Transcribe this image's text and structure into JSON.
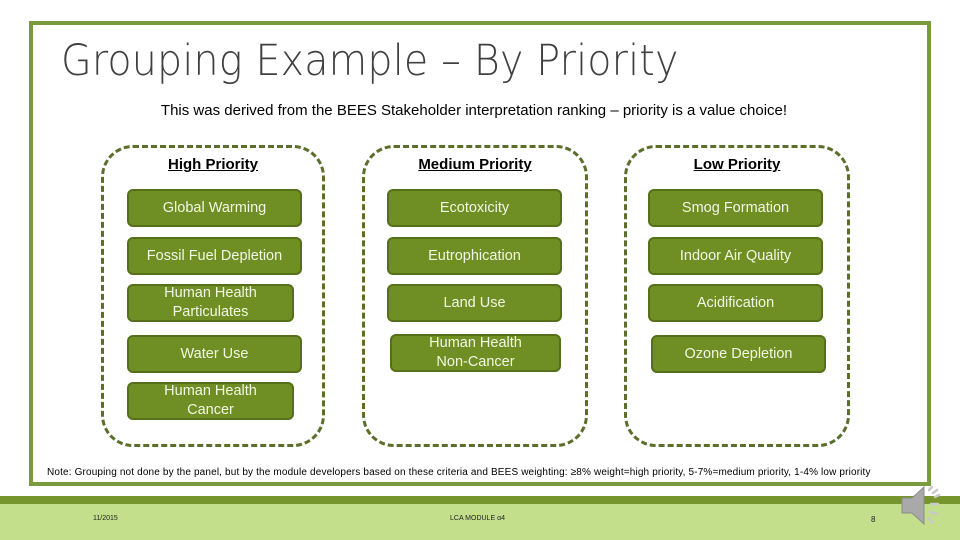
{
  "slide": {
    "title": "Grouping Example – By Priority",
    "subtitle": "This was derived from the BEES Stakeholder interpretation ranking – priority is a value choice!",
    "groups": [
      {
        "heading": "High Priority",
        "items": [
          "Global Warming",
          "Fossil Fuel Depletion",
          "Human Health Particulates",
          "Water Use",
          "Human Health Cancer"
        ]
      },
      {
        "heading": "Medium Priority",
        "items": [
          "Ecotoxicity",
          "Eutrophication",
          "Land Use",
          "Human Health Non-Cancer"
        ]
      },
      {
        "heading": "Low Priority",
        "items": [
          "Smog Formation",
          "Indoor Air Quality",
          "Acidification",
          "Ozone Depletion"
        ]
      }
    ],
    "note": "Note: Grouping not done by the panel, but by the module developers based on these criteria and BEES weighting:  ≥8% weight=high priority, 5-7%=medium priority, 1-4% low priority"
  },
  "footer": {
    "date": "11/2015",
    "module": "LCA MODULE α4",
    "page_number": "8"
  },
  "icons": {
    "audio": "speaker-icon"
  },
  "colors": {
    "frame": "#7a9a3e",
    "box_fill": "#6f8e23",
    "box_border": "#566f1a",
    "dashed": "#5b6e2a",
    "footer_dark": "#76952c",
    "footer_light": "#c3df8c"
  }
}
